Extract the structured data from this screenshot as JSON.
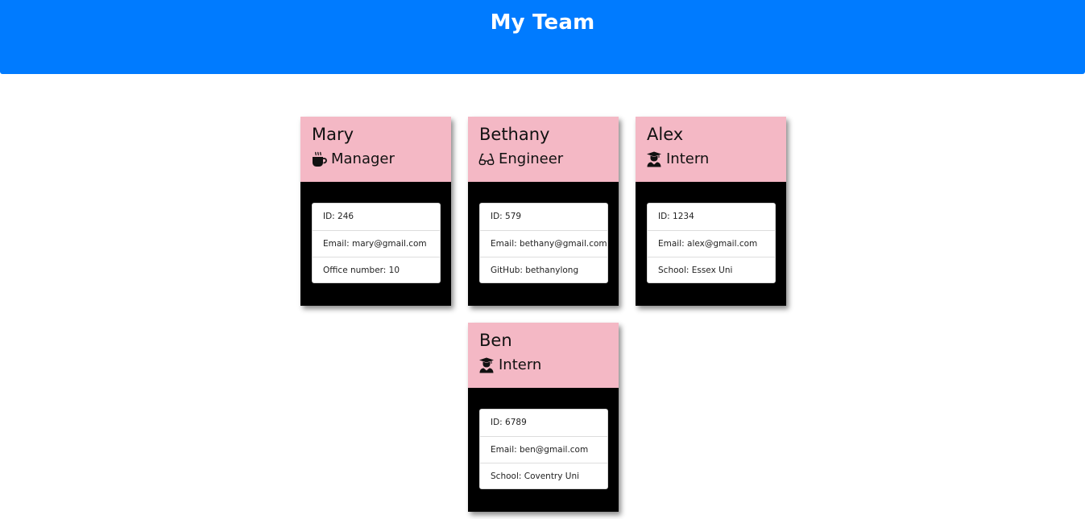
{
  "header": {
    "title": "My Team"
  },
  "team": [
    {
      "name": "Mary",
      "role": "Manager",
      "role_icon": "coffee-icon",
      "id_text": "ID: 246",
      "email_text": "Email: mary@gmail.com",
      "extra_text": "Office number: 10"
    },
    {
      "name": "Bethany",
      "role": "Engineer",
      "role_icon": "glasses-icon",
      "id_text": "ID: 579",
      "email_text": "Email: bethany@gmail.com",
      "extra_text": "GitHub: bethanylong"
    },
    {
      "name": "Alex",
      "role": "Intern",
      "role_icon": "graduate-icon",
      "id_text": "ID: 1234",
      "email_text": "Email: alex@gmail.com",
      "extra_text": "School: Essex Uni"
    },
    {
      "name": "Ben",
      "role": "Intern",
      "role_icon": "graduate-icon",
      "id_text": "ID: 6789",
      "email_text": "Email: ben@gmail.com",
      "extra_text": "School: Coventry Uni"
    }
  ],
  "colors": {
    "header_bg": "#007bff",
    "card_head_bg": "#f4b8c5",
    "card_body_bg": "#000000"
  }
}
